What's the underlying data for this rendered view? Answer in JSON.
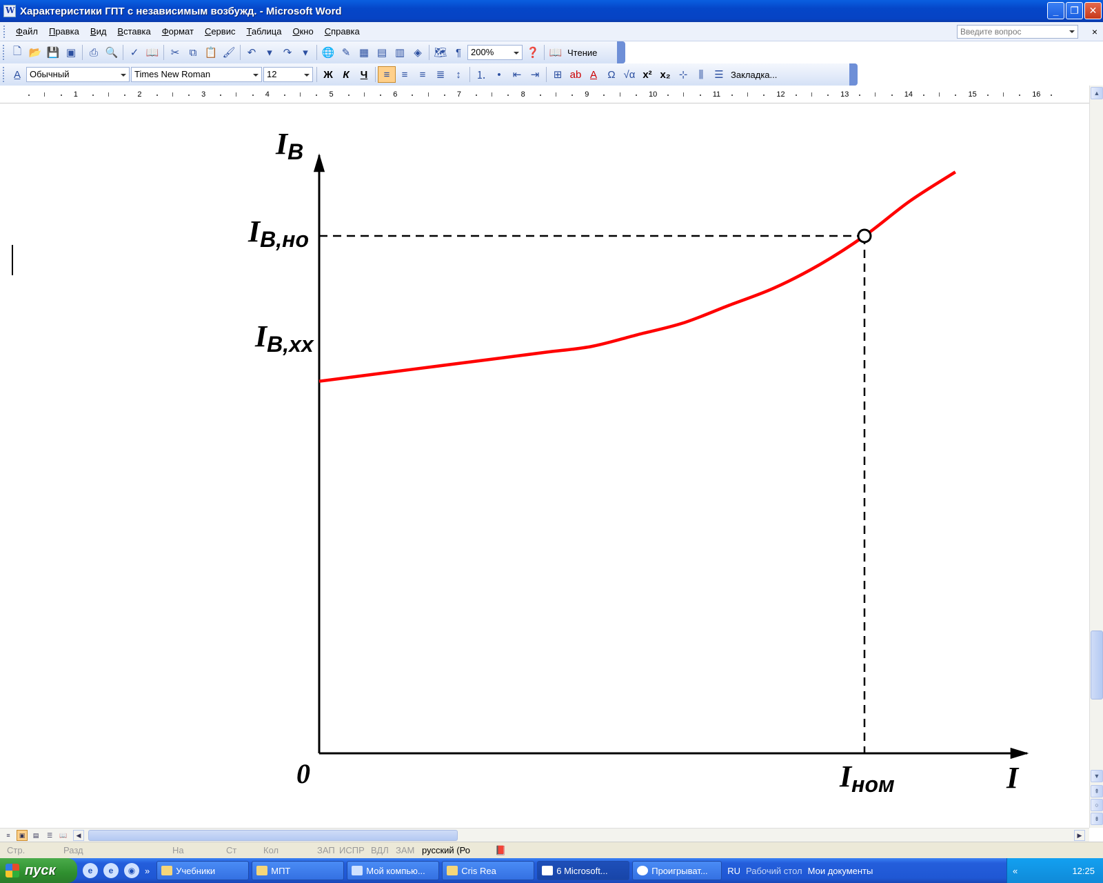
{
  "window": {
    "title": "Характеристики ГПТ с независимым возбужд. - Microsoft Word",
    "minimize": "_",
    "maximize": "❐",
    "close": "✕"
  },
  "menu": {
    "items": [
      "Файл",
      "Правка",
      "Вид",
      "Вставка",
      "Формат",
      "Сервис",
      "Таблица",
      "Окно",
      "Справка"
    ],
    "help_placeholder": "Введите вопрос",
    "close": "×"
  },
  "toolbar1": {
    "zoom": "200%",
    "reading": "Чтение",
    "pilcrow": "¶"
  },
  "toolbar2": {
    "style": "Обычный",
    "font": "Times New Roman",
    "size": "12",
    "bold": "Ж",
    "italic": "К",
    "underline": "Ч",
    "omega": "Ω",
    "bookmark": "Закладка..."
  },
  "ruler": {
    "numbers": [
      "1",
      "2",
      "3",
      "4",
      "5",
      "6",
      "7",
      "8",
      "9",
      "10",
      "11",
      "12",
      "13",
      "14",
      "15",
      "16"
    ]
  },
  "chart_data": {
    "type": "line",
    "series": [
      {
        "x": [
          0,
          1,
          2,
          3,
          4,
          5,
          6,
          7,
          8,
          9,
          10,
          11,
          12,
          13,
          14
        ],
        "y": [
          0.64,
          0.65,
          0.66,
          0.67,
          0.68,
          0.69,
          0.7,
          0.72,
          0.74,
          0.77,
          0.8,
          0.84,
          0.89,
          0.95,
          1.0
        ]
      }
    ],
    "marker": {
      "x": 12.0,
      "y": 0.89
    },
    "xlabel": "I",
    "ylabel": "IB",
    "origin_label": "0",
    "x_tick_label": {
      "main": "I",
      "sub": "ном"
    },
    "y_tick_labels": [
      {
        "main": "I",
        "sub": "B,но"
      },
      {
        "main": "I",
        "sub": "B,xx"
      }
    ],
    "xlim": [
      0,
      15.5
    ],
    "ylim": [
      0,
      1.2
    ],
    "line_color": "#ff0000"
  },
  "status": {
    "page": "Стр.",
    "section": "Разд",
    "at": "На",
    "line": "Ст",
    "column": "Кол",
    "rec": "ЗАП",
    "trk": "ИСПР",
    "ext": "ВДЛ",
    "ovr": "ЗАМ",
    "language": "русский (Ро"
  },
  "taskbar": {
    "start": "пуск",
    "tasks": [
      "Учебники",
      "МПТ",
      "Мой компью...",
      "Cris Rea",
      "6 Microsoft...",
      "Проигрыват..."
    ],
    "lang": "RU",
    "desktop": "Рабочий стол",
    "docs": "Мои документы",
    "clock": "12:25"
  }
}
